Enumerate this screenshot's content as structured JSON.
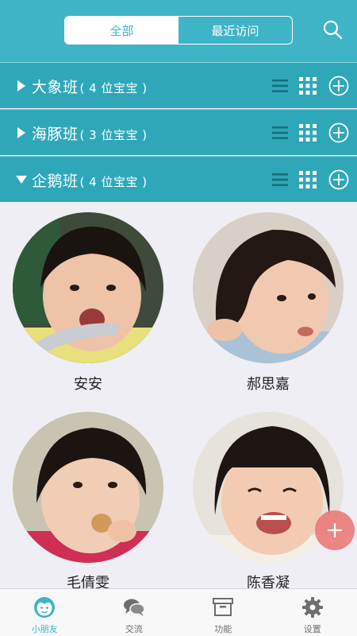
{
  "header": {
    "tabs": [
      "全部",
      "最近访问"
    ],
    "active_tab": 0,
    "icons": [
      "search-icon"
    ]
  },
  "groups": [
    {
      "name": "大象班",
      "count_text": "( 4 位宝宝 )",
      "expanded": false
    },
    {
      "name": "海豚班",
      "count_text": "( 3 位宝宝 )",
      "expanded": false
    },
    {
      "name": "企鹅班",
      "count_text": "( 4 位宝宝 )",
      "expanded": true
    }
  ],
  "group_icons": [
    "list-icon",
    "grid-icon",
    "add-circle-icon"
  ],
  "children": [
    {
      "name": "安安"
    },
    {
      "name": "郝思嘉"
    },
    {
      "name": "毛倩雯"
    },
    {
      "name": "陈香凝"
    }
  ],
  "tabbar": [
    {
      "label": "小朋友",
      "icon": "baby-face-icon",
      "active": true
    },
    {
      "label": "交流",
      "icon": "chat-bubbles-icon",
      "active": false
    },
    {
      "label": "功能",
      "icon": "box-icon",
      "active": false
    },
    {
      "label": "设置",
      "icon": "gear-icon",
      "active": false
    }
  ],
  "colors": {
    "accent": "#3eb4c6",
    "group_bar": "#2ea8b9",
    "background": "#efeef4",
    "fab": "#ec6e6e"
  }
}
